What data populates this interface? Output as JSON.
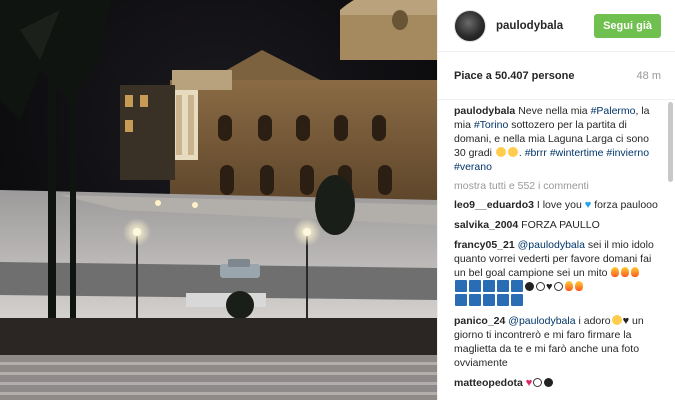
{
  "header": {
    "username": "paulodybala",
    "follow_label": "Segui già"
  },
  "meta": {
    "likes": "Piace a 50.407 persone",
    "time": "48 m"
  },
  "caption": {
    "user": "paulodybala",
    "t1": "Neve nella mia ",
    "tag1": "#Palermo",
    "t2": ", la mia ",
    "tag2": "#Torino",
    "t3": " sottozero per la partita di domani, e nella mia Laguna Larga ci sono 30 gradi ",
    "t4": ". ",
    "tag3": "#brrr",
    "tag4": "#wintertime",
    "tag5": "#invierno",
    "tag6": "#verano"
  },
  "more_comments": "mostra tutti e 552 i commenti",
  "comments": [
    {
      "user": "leo9__eduardo3",
      "text": "I love you",
      "text2": "forza paulooo"
    },
    {
      "user": "salvika_2004",
      "text": "FORZA PAULLO"
    },
    {
      "user": "francy05_21",
      "mention": "@paulodybala",
      "text": " sei il mio idolo quanto vorrei vederti per favore domani fai un bel goal campione sei un mito "
    },
    {
      "user": "panico_24",
      "mention": "@paulodybala",
      "text": " i adoro",
      "text2": " un giorno ti incontrerò e mi faro firmare la maglietta da te e mi farò anche una foto ovviamente"
    },
    {
      "user": "matteopedota",
      "text": ""
    }
  ],
  "icons": {
    "heart": "blue-heart-icon",
    "fire": "fire-icon",
    "flag": "flag-icon"
  },
  "colors": {
    "follow": "#70c050",
    "hashtag": "#003569"
  }
}
